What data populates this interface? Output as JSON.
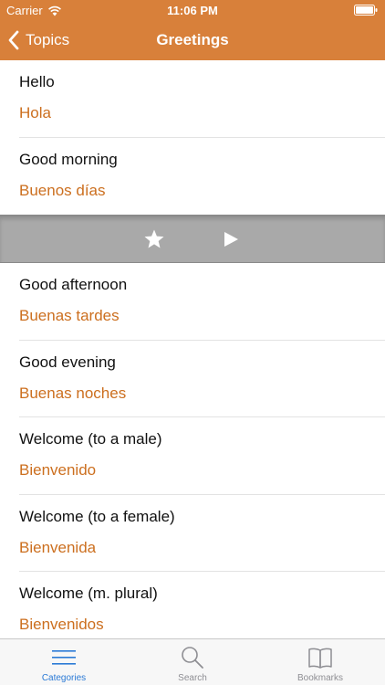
{
  "status_bar": {
    "carrier": "Carrier",
    "time": "11:06 PM"
  },
  "nav": {
    "back_label": "Topics",
    "title": "Greetings"
  },
  "phrases_top": [
    {
      "english": "Hello",
      "spanish": "Hola"
    },
    {
      "english": "Good morning",
      "spanish": "Buenos días"
    }
  ],
  "action_bar": {
    "icons": [
      "star-icon",
      "play-icon"
    ]
  },
  "phrases_bottom": [
    {
      "english": "Good afternoon",
      "spanish": "Buenas tardes"
    },
    {
      "english": "Good evening",
      "spanish": "Buenas noches"
    },
    {
      "english": "Welcome (to a male)",
      "spanish": "Bienvenido"
    },
    {
      "english": "Welcome (to a female)",
      "spanish": "Bienvenida"
    },
    {
      "english": "Welcome (m. plural)",
      "spanish": "Bienvenidos"
    }
  ],
  "tabs": [
    {
      "label": "Categories",
      "icon": "list-icon",
      "active": true
    },
    {
      "label": "Search",
      "icon": "search-icon",
      "active": false
    },
    {
      "label": "Bookmarks",
      "icon": "book-icon",
      "active": false
    }
  ],
  "colors": {
    "header": "#d8803a",
    "spanish_text": "#cc6f1f",
    "tab_active": "#2b7ad6",
    "tab_inactive": "#8e8e93",
    "action_bar": "#a9a9a9"
  }
}
